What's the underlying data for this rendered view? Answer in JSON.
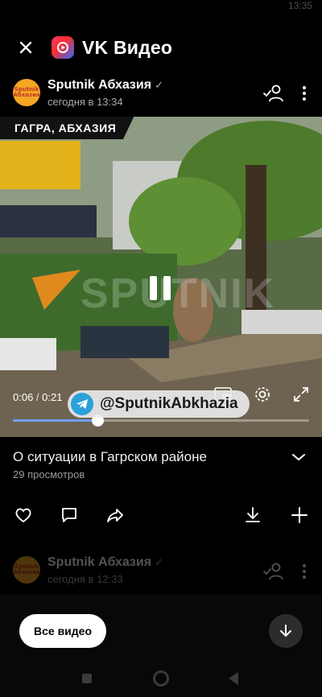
{
  "status_bar": {
    "time": "13:35"
  },
  "header": {
    "app_title": "VK Видео",
    "close_icon": "close-icon",
    "logo_icon": "vk-video-logo-icon"
  },
  "post": {
    "channel_name": "Sputnik Абхазия",
    "avatar_text": "Sputnik Абхазия",
    "posted_time": "сегодня в 13:34"
  },
  "video": {
    "location_chip": "ГАГРА, АБХАЗИЯ",
    "watermark": "SPUTNIK",
    "current_time": "0:06",
    "duration": "0:21",
    "progress": 0.285,
    "telegram_handle": "@SputnikAbkhazia",
    "title": "О ситуации в Гагрском районе",
    "views": "29 просмотров"
  },
  "next_post": {
    "channel_name": "Sputnik Абхазия",
    "avatar_text": "Sputnik Абхазия",
    "posted_time": "сегодня в 12:33"
  },
  "footer": {
    "all_videos_label": "Все видео"
  },
  "colors": {
    "accent": "#6fa0ff",
    "background": "#000000",
    "telegram": "#2aa1da"
  }
}
